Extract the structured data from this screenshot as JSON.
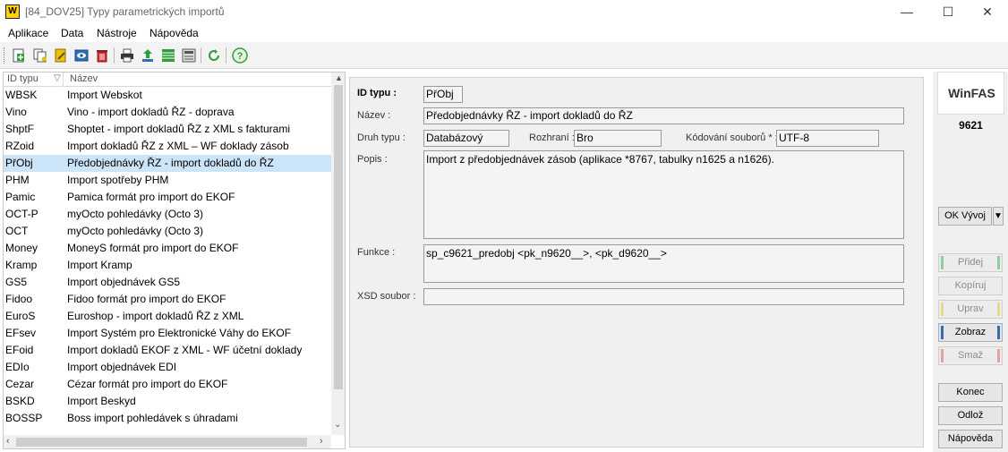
{
  "window": {
    "logo_text": "W",
    "title": "[84_DOV25] Typy parametrických importů",
    "minimize": "—",
    "maximize": "☐",
    "close": "✕"
  },
  "menu": [
    "Aplikace",
    "Data",
    "Nástroje",
    "Nápověda"
  ],
  "toolbar": {
    "icons": [
      "add-icon",
      "copy-icon",
      "edit-icon",
      "view-icon",
      "delete-icon",
      "print-icon",
      "export-icon",
      "table-icon",
      "columns-icon",
      "refresh-icon",
      "help-icon"
    ],
    "colors": {
      "green": "#2e9e3a",
      "yellow": "#f0c000",
      "blue": "#2f6fb5",
      "red": "#d23030"
    }
  },
  "list": {
    "columns": {
      "id": "ID typu",
      "name": "Název"
    },
    "rows": [
      {
        "id": "WBSK",
        "name": "Import Webskot"
      },
      {
        "id": "Vino",
        "name": "Vino - import dokladů ŘZ - doprava"
      },
      {
        "id": "ShptF",
        "name": "Shoptet - import dokladů ŘZ z XML s fakturami"
      },
      {
        "id": "RZoid",
        "name": "Import dokladů ŘZ z XML – WF doklady zásob"
      },
      {
        "id": "PřObj",
        "name": "Předobjednávky ŘZ - import dokladů do ŘZ"
      },
      {
        "id": "PHM",
        "name": "Import spotřeby PHM"
      },
      {
        "id": "Pamic",
        "name": "Pamica formát pro import do EKOF"
      },
      {
        "id": "OCT-P",
        "name": "myOcto pohledávky (Octo 3)"
      },
      {
        "id": "OCT",
        "name": "myOcto pohledávky (Octo 3)"
      },
      {
        "id": "Money",
        "name": "MoneyS formát pro import do EKOF"
      },
      {
        "id": "Kramp",
        "name": "Import Kramp"
      },
      {
        "id": "GS5",
        "name": "Import objednávek GS5"
      },
      {
        "id": "Fidoo",
        "name": "Fidoo formát pro import do EKOF"
      },
      {
        "id": "EuroS",
        "name": "Euroshop - import dokladů ŘZ z XML"
      },
      {
        "id": "EFsev",
        "name": "Import Systém pro Elektronické Váhy do EKOF"
      },
      {
        "id": "EFoid",
        "name": "Import dokladů EKOF z XML - WF účetní doklady"
      },
      {
        "id": "EDIo",
        "name": "Import objednávek EDI"
      },
      {
        "id": "Cezar",
        "name": "Cézar formát pro import do EKOF"
      },
      {
        "id": "BSKD",
        "name": "Import Beskyd"
      },
      {
        "id": "BOSSP",
        "name": "Boss import pohledávek s úhradami"
      }
    ],
    "selected_index": 4
  },
  "detail": {
    "id_label": "ID typu :",
    "id_value": "PřObj",
    "name_label": "Název :",
    "name_value": "Předobjednávky ŘZ - import dokladů do ŘZ",
    "kind_label": "Druh typu :",
    "kind_value": "Databázový",
    "interface_label": "Rozhraní :",
    "interface_value": "Bro",
    "encoding_label": "Kódování souborů * :",
    "encoding_value": "UTF-8",
    "desc_label": "Popis :",
    "desc_value": "Import z předobjednávek zásob (aplikace *8767, tabulky n1625 a n1626).",
    "func_label": "Funkce :",
    "func_value": "sp_c9621_predobj <pk_n9620__>, <pk_d9620__>",
    "xsd_label": "XSD soubor :",
    "xsd_value": ""
  },
  "side": {
    "brand": "WinFAS",
    "number": "9621",
    "ok_label": "OK Vývoj",
    "ok_arrow": "▼",
    "buttons": {
      "add": "Přidej",
      "copy": "Kopíruj",
      "edit": "Uprav",
      "view": "Zobraz",
      "delete": "Smaž",
      "end": "Konec",
      "send": "Odlož",
      "help": "Nápověda"
    }
  }
}
